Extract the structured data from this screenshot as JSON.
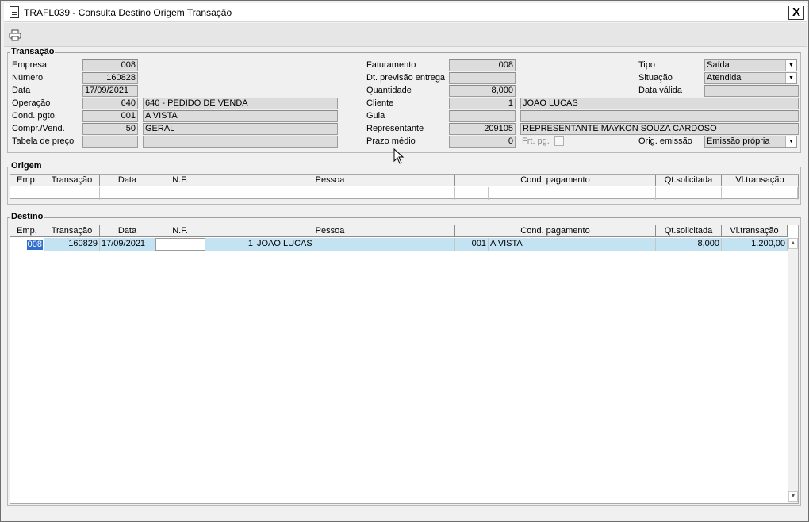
{
  "window": {
    "title": "TRAFL039 - Consulta Destino Origem Transação",
    "close_label": "X"
  },
  "transacao": {
    "group_label": "Transação",
    "empresa": {
      "label": "Empresa",
      "value": "008"
    },
    "numero": {
      "label": "Número",
      "value": "160828"
    },
    "data": {
      "label": "Data",
      "value": "17/09/2021"
    },
    "operacao": {
      "label": "Operação",
      "code": "640",
      "desc": "640 - PEDIDO DE VENDA"
    },
    "cond_pgto": {
      "label": "Cond. pgto.",
      "code": "001",
      "desc": "A VISTA"
    },
    "compr_vend": {
      "label": "Compr./Vend.",
      "code": "50",
      "desc": "GERAL"
    },
    "tabela_preco": {
      "label": "Tabela de preço",
      "code": "",
      "desc": ""
    },
    "faturamento": {
      "label": "Faturamento",
      "value": "008"
    },
    "dt_previsao": {
      "label": "Dt. previsão entrega",
      "value": ""
    },
    "quantidade": {
      "label": "Quantidade",
      "value": "8,000"
    },
    "cliente": {
      "label": "Cliente",
      "code": "1",
      "name": "JOAO LUCAS"
    },
    "guia": {
      "label": "Guia",
      "code": "",
      "name": ""
    },
    "representante": {
      "label": "Representante",
      "code": "209105",
      "name": "REPRESENTANTE MAYKON SOUZA CARDOSO"
    },
    "prazo_medio": {
      "label": "Prazo médio",
      "value": "0"
    },
    "frt_pg": {
      "label": "Frt. pg."
    },
    "tipo": {
      "label": "Tipo",
      "value": "Saída"
    },
    "situacao": {
      "label": "Situação",
      "value": "Atendida"
    },
    "data_valida": {
      "label": "Data válida",
      "value": ""
    },
    "orig_emissao": {
      "label": "Orig. emissão",
      "value": "Emissão própria"
    }
  },
  "grid_headers": [
    "Emp.",
    "Transação",
    "Data",
    "N.F.",
    "Pessoa",
    "Cond. pagamento",
    "Qt.solicitada",
    "Vl.transação"
  ],
  "origem": {
    "group_label": "Origem"
  },
  "destino": {
    "group_label": "Destino",
    "row": {
      "emp": "008",
      "transacao": "160829",
      "data": "17/09/2021",
      "nf": "",
      "pessoa_code": "1",
      "pessoa_name": "JOAO LUCAS",
      "cond_code": "001",
      "cond_desc": "A VISTA",
      "qt": "8,000",
      "vl": "1.200,00"
    }
  },
  "colors": {
    "selected_row": "#c3e3f3",
    "selected_cell": "#2f6fcf",
    "field_bg": "#dcdcdc"
  }
}
